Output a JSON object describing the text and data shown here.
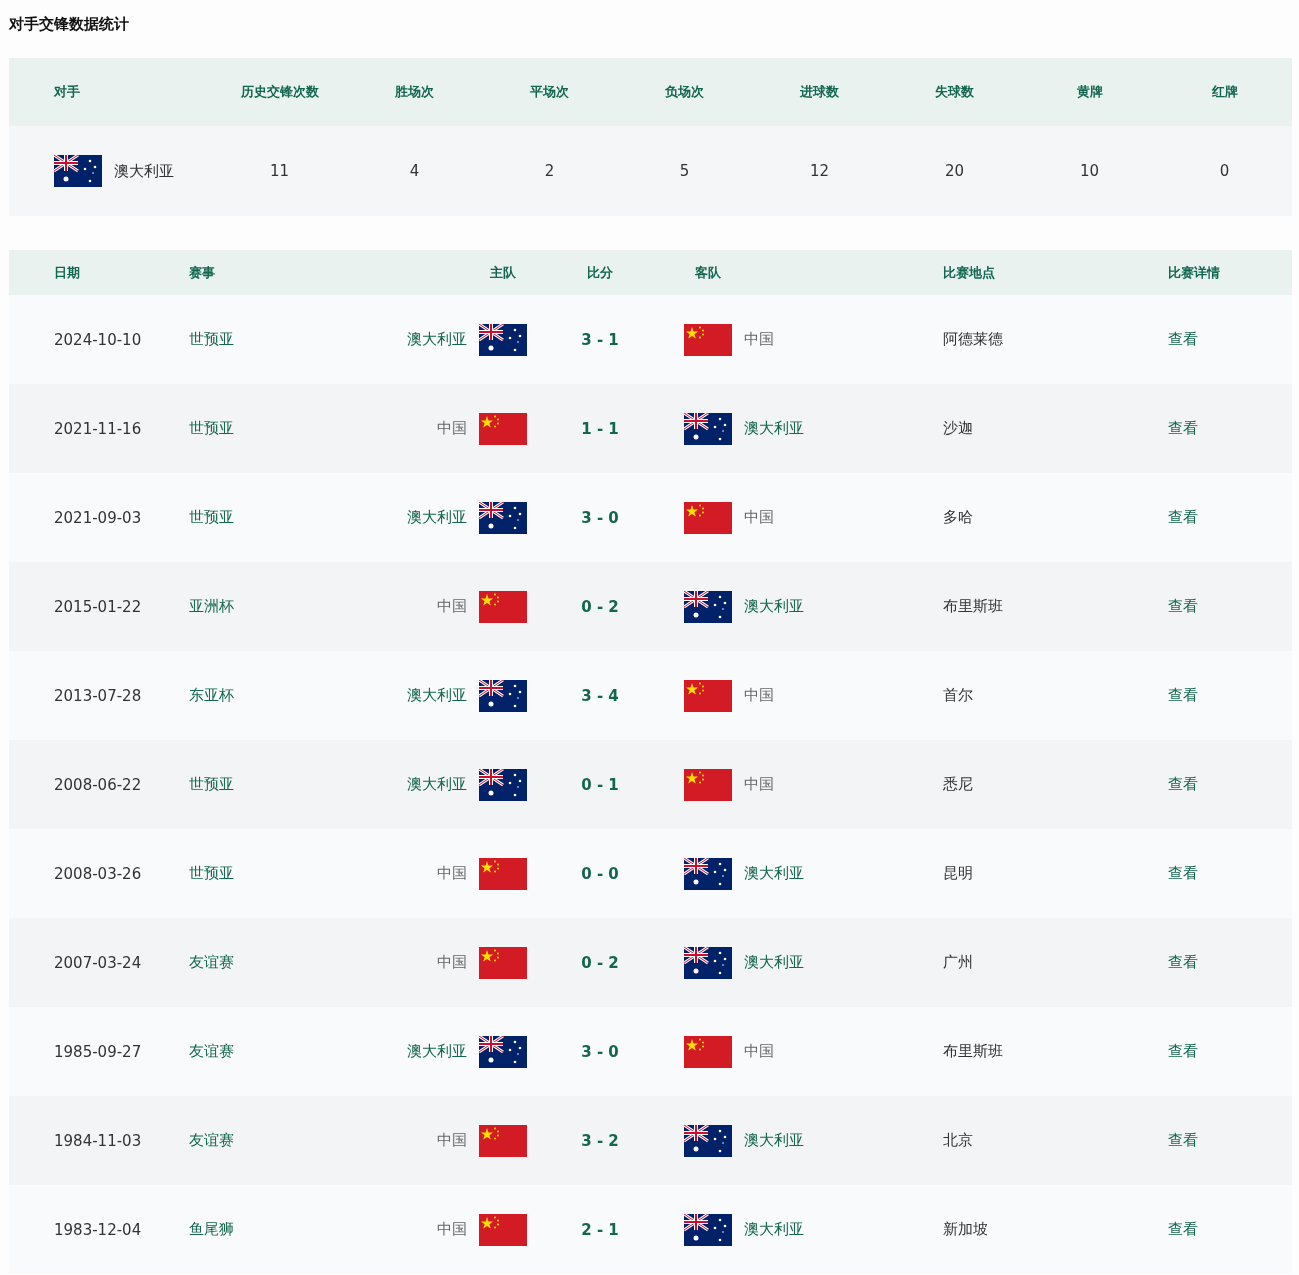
{
  "title": "对手交锋数据统计",
  "summary": {
    "columns": [
      "对手",
      "历史交锋次数",
      "胜场次",
      "平场次",
      "负场次",
      "进球数",
      "失球数",
      "黄牌",
      "红牌"
    ],
    "row": {
      "opponent": {
        "name": "澳大利亚",
        "kind": "australia"
      },
      "values": [
        "11",
        "4",
        "2",
        "5",
        "12",
        "20",
        "10",
        "0"
      ]
    }
  },
  "matches": {
    "columns": [
      "日期",
      "赛事",
      "主队",
      "比分",
      "客队",
      "比赛地点",
      "比赛详情"
    ],
    "rows": [
      {
        "date": "2024-10-10",
        "competition": "世预亚",
        "home": {
          "name": "澳大利亚",
          "kind": "australia",
          "linked": true
        },
        "score": "3 - 1",
        "away": {
          "name": "中国",
          "kind": "china",
          "linked": false
        },
        "venue": "阿德莱德",
        "details": "查看"
      },
      {
        "date": "2021-11-16",
        "competition": "世预亚",
        "home": {
          "name": "中国",
          "kind": "china",
          "linked": false
        },
        "score": "1 - 1",
        "away": {
          "name": "澳大利亚",
          "kind": "australia",
          "linked": true
        },
        "venue": "沙迦",
        "details": "查看"
      },
      {
        "date": "2021-09-03",
        "competition": "世预亚",
        "home": {
          "name": "澳大利亚",
          "kind": "australia",
          "linked": true
        },
        "score": "3 - 0",
        "away": {
          "name": "中国",
          "kind": "china",
          "linked": false
        },
        "venue": "多哈",
        "details": "查看"
      },
      {
        "date": "2015-01-22",
        "competition": "亚洲杯",
        "home": {
          "name": "中国",
          "kind": "china",
          "linked": false
        },
        "score": "0 - 2",
        "away": {
          "name": "澳大利亚",
          "kind": "australia",
          "linked": true
        },
        "venue": "布里斯班",
        "details": "查看"
      },
      {
        "date": "2013-07-28",
        "competition": "东亚杯",
        "home": {
          "name": "澳大利亚",
          "kind": "australia",
          "linked": true
        },
        "score": "3 - 4",
        "away": {
          "name": "中国",
          "kind": "china",
          "linked": false
        },
        "venue": "首尔",
        "details": "查看"
      },
      {
        "date": "2008-06-22",
        "competition": "世预亚",
        "home": {
          "name": "澳大利亚",
          "kind": "australia",
          "linked": true
        },
        "score": "0 - 1",
        "away": {
          "name": "中国",
          "kind": "china",
          "linked": false
        },
        "venue": "悉尼",
        "details": "查看"
      },
      {
        "date": "2008-03-26",
        "competition": "世预亚",
        "home": {
          "name": "中国",
          "kind": "china",
          "linked": false
        },
        "score": "0 - 0",
        "away": {
          "name": "澳大利亚",
          "kind": "australia",
          "linked": true
        },
        "venue": "昆明",
        "details": "查看"
      },
      {
        "date": "2007-03-24",
        "competition": "友谊赛",
        "home": {
          "name": "中国",
          "kind": "china",
          "linked": false
        },
        "score": "0 - 2",
        "away": {
          "name": "澳大利亚",
          "kind": "australia",
          "linked": true
        },
        "venue": "广州",
        "details": "查看"
      },
      {
        "date": "1985-09-27",
        "competition": "友谊赛",
        "home": {
          "name": "澳大利亚",
          "kind": "australia",
          "linked": true
        },
        "score": "3 - 0",
        "away": {
          "name": "中国",
          "kind": "china",
          "linked": false
        },
        "venue": "布里斯班",
        "details": "查看"
      },
      {
        "date": "1984-11-03",
        "competition": "友谊赛",
        "home": {
          "name": "中国",
          "kind": "china",
          "linked": false
        },
        "score": "3 - 2",
        "away": {
          "name": "澳大利亚",
          "kind": "australia",
          "linked": true
        },
        "venue": "北京",
        "details": "查看"
      },
      {
        "date": "1983-12-04",
        "competition": "鱼尾狮",
        "home": {
          "name": "中国",
          "kind": "china",
          "linked": false
        },
        "score": "2 - 1",
        "away": {
          "name": "澳大利亚",
          "kind": "australia",
          "linked": true
        },
        "venue": "新加坡",
        "details": "查看"
      }
    ]
  }
}
